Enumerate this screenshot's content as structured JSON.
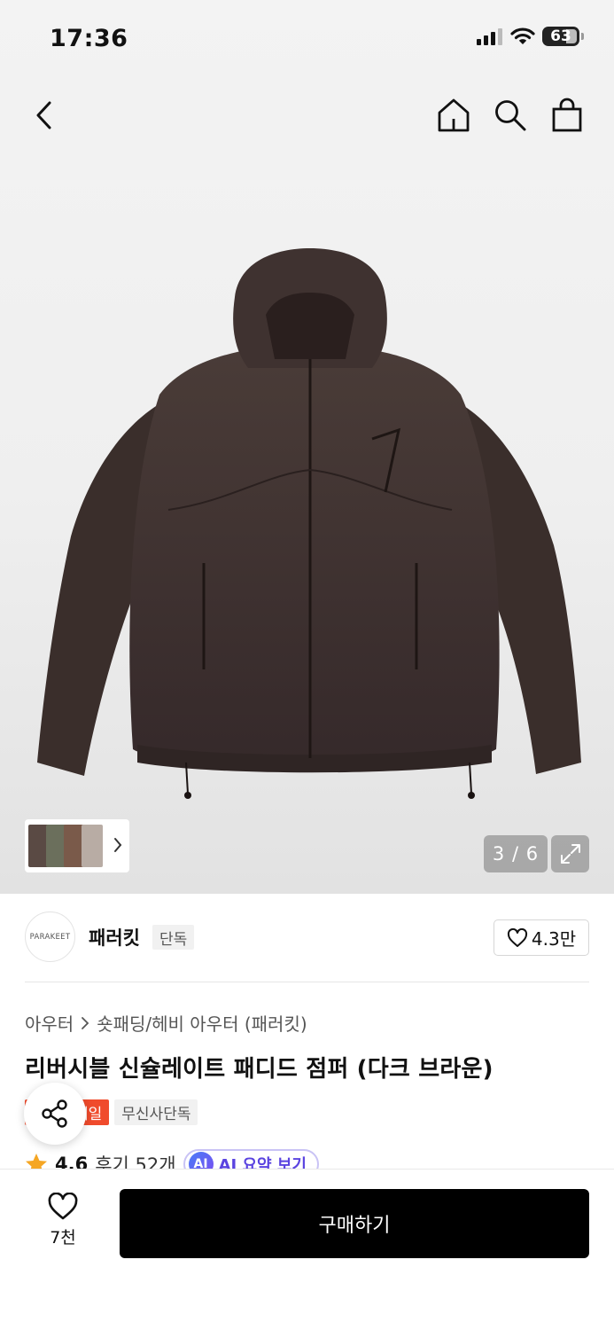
{
  "status_bar": {
    "time": "17:36",
    "battery": "63"
  },
  "gallery": {
    "counter": "3 / 6"
  },
  "brand": {
    "logo_text": "PARAKEET",
    "name": "패러킷",
    "badge": "단독",
    "likes": "4.3만"
  },
  "breadcrumb": {
    "category": "아우터",
    "subcategory": "숏패딩/헤비 아우터 (패러킷)"
  },
  "product": {
    "title": "리버시블 신슐레이트 패디드 점퍼 (다크 브라운)",
    "tags": [
      "세일",
      "무신사단독"
    ],
    "rating": "4.6",
    "reviews": "후기 52개",
    "ai_summary_label": "AI 요약 보기",
    "ai_badge": "AI"
  },
  "bottom_bar": {
    "like_count": "7천",
    "buy_label": "구매하기"
  },
  "colors": {
    "jacket": "#3d302d",
    "sale_tag": "#f04b2c",
    "ai_purple": "#5a43e0"
  }
}
